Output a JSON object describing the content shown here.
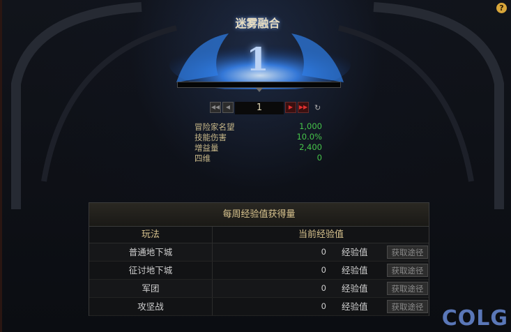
{
  "header": {
    "title": "迷雾融合",
    "level": "1",
    "help_label": "?",
    "progress": 0
  },
  "pager": {
    "first": "◀◀",
    "prev": "◀",
    "page": "1",
    "next": "▶",
    "last": "▶▶",
    "refresh": "↻"
  },
  "stats": [
    {
      "label": "冒险家名望",
      "value": "1,000"
    },
    {
      "label": "技能伤害",
      "value": "10.0%"
    },
    {
      "label": "增益量",
      "value": "2,400"
    },
    {
      "label": "四维",
      "value": "0"
    }
  ],
  "panel": {
    "title": "每周经验值获得量",
    "col_mode": "玩法",
    "col_exp": "当前经验值",
    "rows": [
      {
        "mode": "普通地下城",
        "value": "0",
        "unit": "经验值",
        "button": "获取途径"
      },
      {
        "mode": "征讨地下城",
        "value": "0",
        "unit": "经验值",
        "button": "获取途径"
      },
      {
        "mode": "军团",
        "value": "0",
        "unit": "经验值",
        "button": "获取途径"
      },
      {
        "mode": "攻坚战",
        "value": "0",
        "unit": "经验值",
        "button": "获取途径"
      }
    ]
  },
  "watermark": "COLG",
  "colors": {
    "accent_blue": "#3b6db0",
    "stat_green": "#46c44a",
    "gold": "#d9c48f"
  }
}
